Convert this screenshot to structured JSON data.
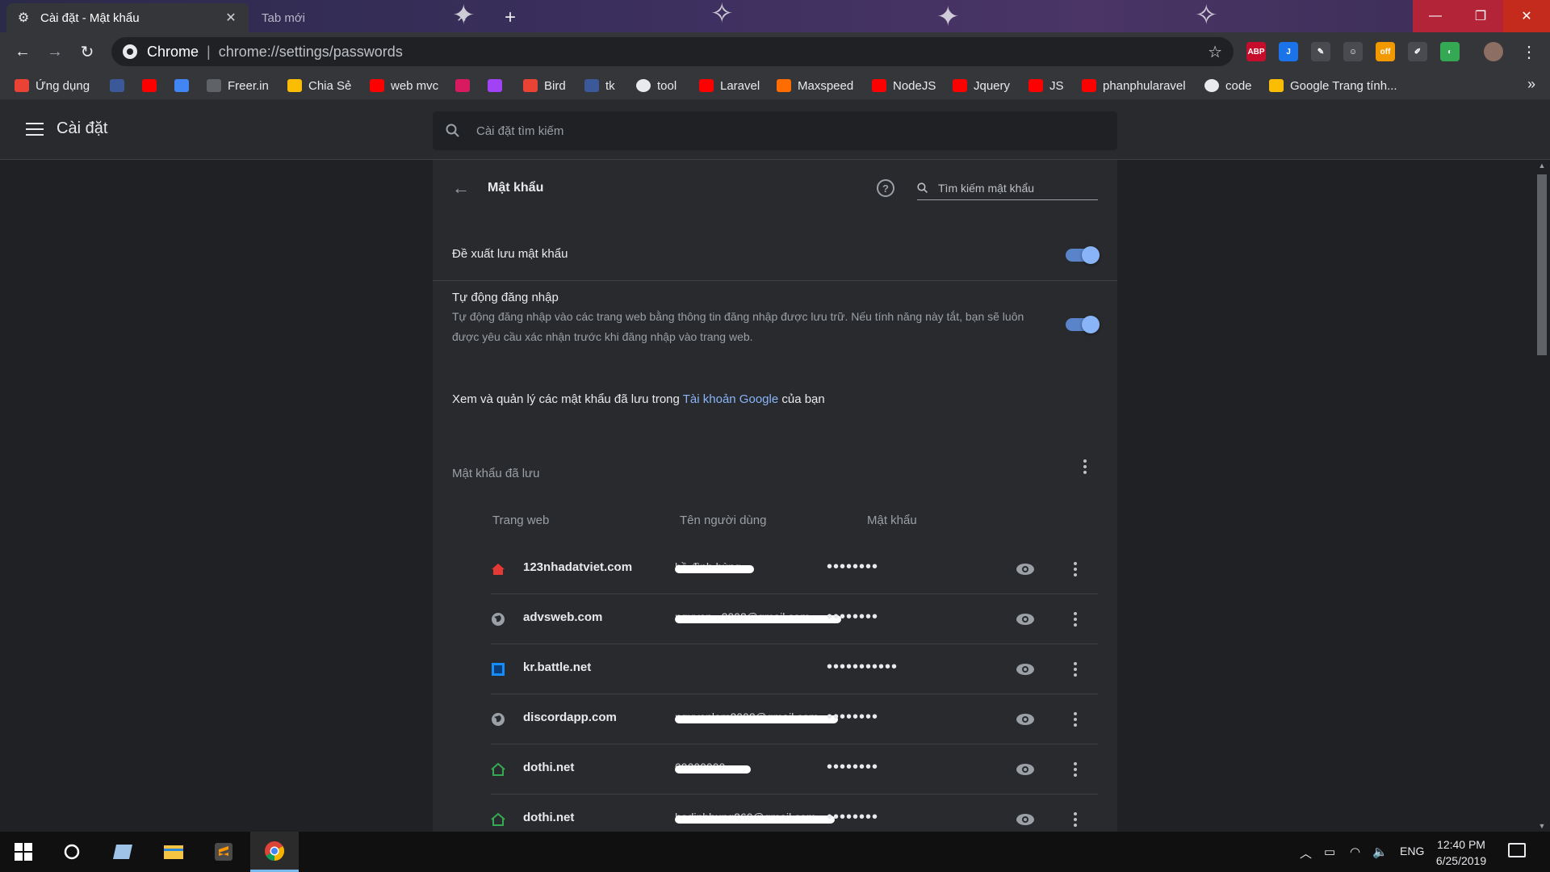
{
  "browser": {
    "tabs": [
      {
        "label": "Cài đặt - Mật khẩu",
        "active": true
      },
      {
        "label": "Tab mới",
        "active": false
      }
    ],
    "omnibox": {
      "chip": "Chrome",
      "url": "chrome://settings/passwords"
    },
    "extensions": [
      {
        "name": "adblock-plus-icon",
        "label": "ABP",
        "color": "#c70d2c"
      },
      {
        "name": "j-extension-icon",
        "label": "J",
        "color": "#1a73e8"
      },
      {
        "name": "pen-extension-icon",
        "label": "",
        "color": "#5f6368"
      },
      {
        "name": "user-extension-icon",
        "label": "",
        "color": "#5f6368"
      },
      {
        "name": "off-badge-extension-icon",
        "label": "off",
        "color": "#f29900"
      },
      {
        "name": "pin-extension-icon",
        "label": "",
        "color": "#5f6368"
      },
      {
        "name": "translate-extension-icon",
        "label": "",
        "color": "#34a853"
      }
    ]
  },
  "bookmarks": [
    {
      "label": "Ứng dụng",
      "icon": "apps-grid-icon",
      "color": "#ea4335"
    },
    {
      "label": "",
      "icon": "facebook-icon",
      "color": "#3b5998"
    },
    {
      "label": "",
      "icon": "youtube-icon",
      "color": "#ff0000"
    },
    {
      "label": "",
      "icon": "google-translate-icon",
      "color": "#4285f4"
    },
    {
      "label": "Freer.in",
      "icon": "freer-icon",
      "color": "#5f6368"
    },
    {
      "label": "Chia Sẻ",
      "icon": "google-drive-icon",
      "color": "#fbbc04"
    },
    {
      "label": "web mvc",
      "icon": "youtube-icon",
      "color": "#ff0000"
    },
    {
      "label": "",
      "icon": "lips-icon",
      "color": "#d81b60"
    },
    {
      "label": "",
      "icon": "infinity-icon",
      "color": "#a142f4"
    },
    {
      "label": "Bird",
      "icon": "bird-icon",
      "color": "#ea4335"
    },
    {
      "label": "tk",
      "icon": "facebook-icon",
      "color": "#3b5998"
    },
    {
      "label": "tool",
      "icon": "globe-icon",
      "color": "#e8eaed"
    },
    {
      "label": "Laravel",
      "icon": "youtube-icon",
      "color": "#ff0000"
    },
    {
      "label": "Maxspeed",
      "icon": "m-icon",
      "color": "#ff6d00"
    },
    {
      "label": "NodeJS",
      "icon": "youtube-icon",
      "color": "#ff0000"
    },
    {
      "label": "Jquery",
      "icon": "youtube-icon",
      "color": "#ff0000"
    },
    {
      "label": "JS",
      "icon": "youtube-icon",
      "color": "#ff0000"
    },
    {
      "label": "phanphularavel",
      "icon": "youtube-icon",
      "color": "#ff0000"
    },
    {
      "label": "code",
      "icon": "globe-icon",
      "color": "#e8eaed"
    },
    {
      "label": "Google Trang tính...",
      "icon": "google-sheets-icon",
      "color": "#fbbc04"
    }
  ],
  "settings": {
    "title": "Cài đặt",
    "search_placeholder": "Cài đặt tìm kiếm",
    "page_title": "Mật khẩu",
    "password_search_placeholder": "Tìm kiếm mật khẩu",
    "offer_to_save": {
      "label": "Đề xuất lưu mật khẩu",
      "enabled": true
    },
    "auto_signin": {
      "label": "Tự động đăng nhập",
      "description": "Tự động đăng nhập vào các trang web bằng thông tin đăng nhập được lưu trữ. Nếu tính năng này tắt, bạn sẽ luôn được yêu cầu xác nhận trước khi đăng nhập vào trang web.",
      "enabled": true
    },
    "manage": {
      "prefix": "Xem và quản lý các mật khẩu đã lưu trong",
      "link": "Tài khoản Google",
      "suffix": "của bạn"
    },
    "saved_title": "Mật khẩu đã lưu",
    "columns": {
      "site": "Trang web",
      "username": "Tên người dùng",
      "password": "Mật khẩu"
    },
    "passwords": [
      {
        "site": "123nhadatviet.com",
        "username": "hồ đình hùng",
        "password": "••••••••",
        "icon": "house-red-icon",
        "redacted": true
      },
      {
        "site": "advsweb.com",
        "username": "nguyen...2002@gmail.com",
        "password": "••••••••",
        "icon": "globe-icon",
        "redacted": true
      },
      {
        "site": "kr.battle.net",
        "username": "",
        "password": "•••••••••••",
        "icon": "battle-net-icon",
        "redacted": false
      },
      {
        "site": "discordapp.com",
        "username": "nguyenlam2002@gmail.com",
        "password": "••••••••",
        "icon": "globe-icon",
        "redacted": true
      },
      {
        "site": "dothi.net",
        "username": "09000000",
        "password": "••••••••",
        "icon": "house-green-icon",
        "redacted": true
      },
      {
        "site": "dothi.net",
        "username": "hodinhhung260@gmail.com",
        "password": "••••••••",
        "icon": "house-green-icon",
        "redacted": true
      }
    ]
  },
  "taskbar": {
    "language": "ENG",
    "time": "12:40 PM",
    "date": "6/25/2019"
  }
}
